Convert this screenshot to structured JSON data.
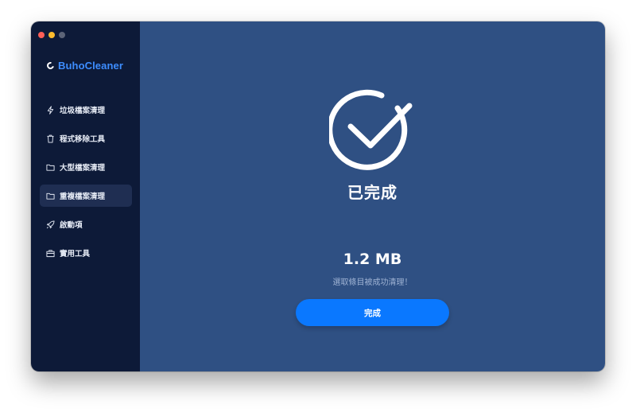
{
  "app": {
    "name": "BuhoCleaner"
  },
  "sidebar": {
    "items": [
      {
        "label": "垃圾檔案清理",
        "icon": "lightning-icon",
        "active": false
      },
      {
        "label": "程式移除工具",
        "icon": "trash-icon",
        "active": false
      },
      {
        "label": "大型檔案清理",
        "icon": "folder-icon",
        "active": false
      },
      {
        "label": "重複檔案清理",
        "icon": "folder-icon",
        "active": true
      },
      {
        "label": "啟動項",
        "icon": "rocket-icon",
        "active": false
      },
      {
        "label": "實用工具",
        "icon": "toolbox-icon",
        "active": false
      }
    ]
  },
  "result": {
    "title": "已完成",
    "size": "1.2 MB",
    "caption": "選取條目被成功清理！",
    "button_label": "完成"
  },
  "colors": {
    "sidebar_bg": "#0d1a38",
    "main_bg": "#2f5083",
    "accent": "#0a78ff",
    "brand": "#3d8dff"
  }
}
